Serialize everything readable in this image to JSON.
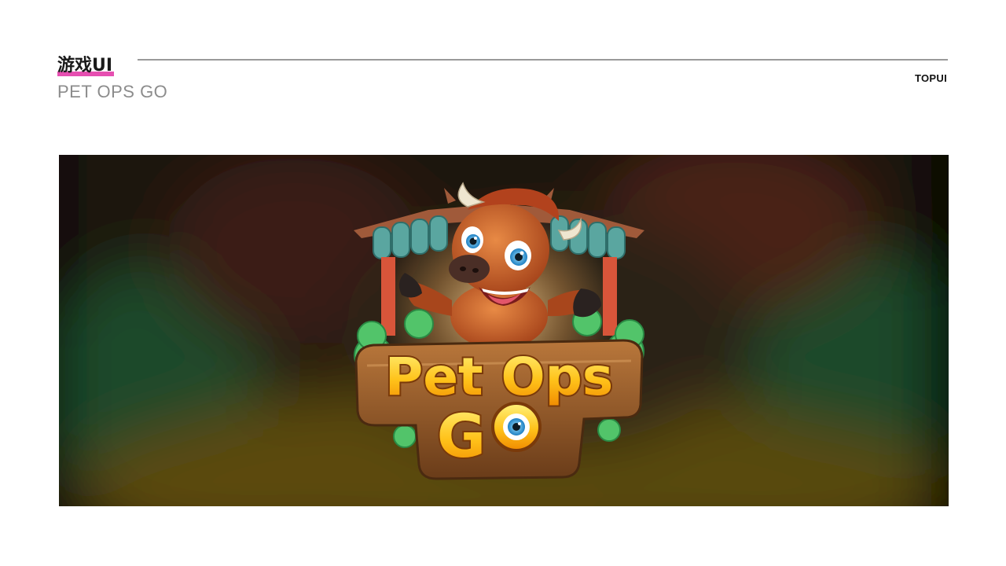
{
  "header": {
    "category_title": "游戏UI",
    "project_name": "PET OPS GO",
    "brand": "TOPUI"
  },
  "showcase": {
    "logo_line1": "Pet Ops",
    "logo_line2_left": "G",
    "logo_line2_right": "O"
  },
  "colors": {
    "accent_underline": "#e64fb1",
    "rule": "#9a9a9a",
    "logo_text": "#ffc21a",
    "logo_wood": "#8a5428"
  }
}
